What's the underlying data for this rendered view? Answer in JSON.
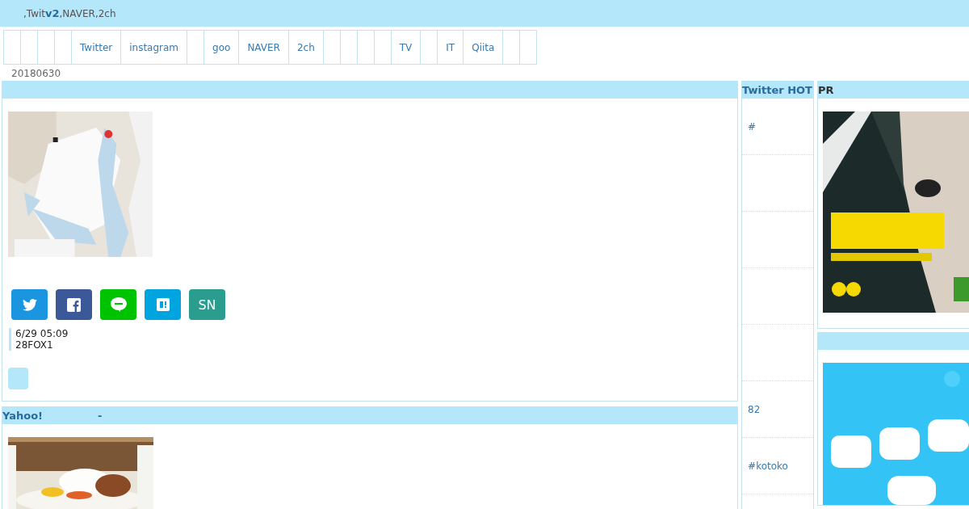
{
  "header": {
    "description_start": ",Twit",
    "logo": "v2",
    "description_end": ",NAVER,2ch"
  },
  "nav": [
    {
      "kind": "blank"
    },
    {
      "kind": "blank"
    },
    {
      "kind": "blank"
    },
    {
      "kind": "blank"
    },
    {
      "kind": "link",
      "label": "Twitter"
    },
    {
      "kind": "link",
      "label": "instagram"
    },
    {
      "kind": "blank"
    },
    {
      "kind": "link",
      "label": "goo"
    },
    {
      "kind": "link",
      "label": "NAVER"
    },
    {
      "kind": "link",
      "label": "2ch"
    },
    {
      "kind": "blank"
    },
    {
      "kind": "blank"
    },
    {
      "kind": "blank"
    },
    {
      "kind": "blank"
    },
    {
      "kind": "link",
      "label": "TV"
    },
    {
      "kind": "blank"
    },
    {
      "kind": "link",
      "label": "IT"
    },
    {
      "kind": "link",
      "label": "Qiita"
    },
    {
      "kind": "blank"
    },
    {
      "kind": "blank"
    }
  ],
  "date": "20180630",
  "articles": [
    {
      "picture": {
        "kind": "picture"
      },
      "share": [
        {
          "kind": "twitter"
        },
        {
          "kind": "facebook"
        },
        {
          "kind": "line"
        },
        {
          "kind": "hatena"
        },
        {
          "kind": "text",
          "label": "SN"
        }
      ],
      "time": "6/29 05:09",
      "source": "28FOX1",
      "more": true
    },
    {
      "title": "Yahoo!",
      "subtitle": "-",
      "picture": {
        "kind": "picture"
      }
    }
  ],
  "hot": {
    "title": "Twitter HOT",
    "items": [
      {
        "kind": "link",
        "text": "#"
      },
      {
        "kind": "blank"
      },
      {
        "kind": "blank"
      },
      {
        "kind": "blank"
      },
      {
        "kind": "blank"
      },
      {
        "kind": "link",
        "text": "82"
      },
      {
        "kind": "link",
        "text": "#kotoko"
      },
      {
        "kind": "blank"
      }
    ]
  },
  "pr": [
    {
      "title": "PR",
      "picture": {
        "kind": "picture"
      }
    },
    {
      "picture": {
        "kind": "picture"
      }
    }
  ]
}
